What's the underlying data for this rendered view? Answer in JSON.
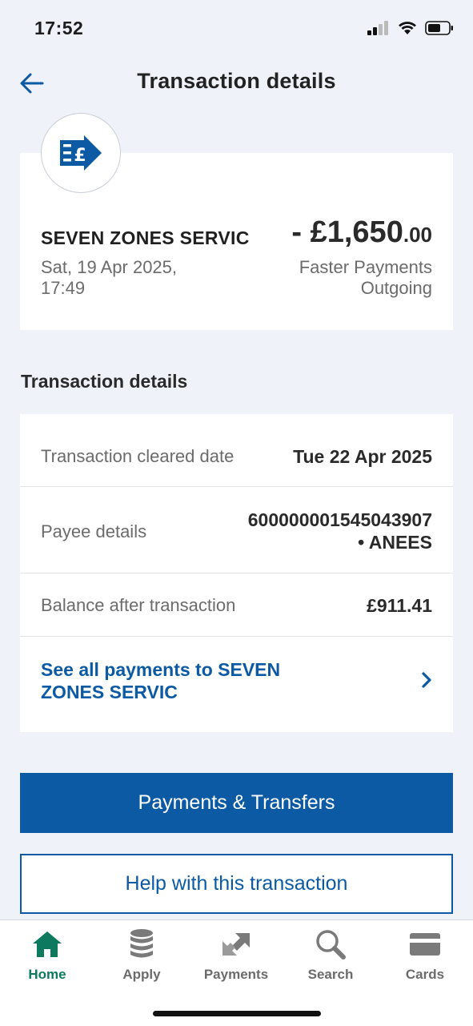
{
  "status_bar": {
    "time": "17:52"
  },
  "header": {
    "title": "Transaction details",
    "back_icon": "arrow-left-icon"
  },
  "summary": {
    "merchant_icon": "pound-transfer-icon",
    "merchant_name": "SEVEN ZONES SERVIC",
    "date": "Sat, 19 Apr 2025,",
    "time": "17:49",
    "amount_main": "- £1,650",
    "amount_pence": ".00",
    "type_line1": "Faster Payments",
    "type_line2": "Outgoing"
  },
  "details": {
    "section_title": "Transaction details",
    "rows": [
      {
        "label": "Transaction cleared date",
        "value": "Tue 22 Apr 2025"
      },
      {
        "label": "Payee details",
        "value_line1": "600000001545043907",
        "value_line2": "• ANEES"
      },
      {
        "label": "Balance after transaction",
        "value": "£911.41"
      }
    ],
    "link_line1": "See all payments to SEVEN",
    "link_line2": "ZONES SERVIC"
  },
  "buttons": {
    "primary": "Payments & Transfers",
    "secondary": "Help with this transaction"
  },
  "bottom_nav": {
    "items": [
      {
        "label": "Home",
        "icon": "home-icon",
        "active": true
      },
      {
        "label": "Apply",
        "icon": "coins-stack-icon",
        "active": false
      },
      {
        "label": "Payments",
        "icon": "transfer-arrows-icon",
        "active": false
      },
      {
        "label": "Search",
        "icon": "search-icon",
        "active": false
      },
      {
        "label": "Cards",
        "icon": "card-icon",
        "active": false
      }
    ]
  },
  "colors": {
    "accent": "#0b5aa3",
    "active_nav": "#0d7a5f",
    "background": "#eff2f8"
  }
}
